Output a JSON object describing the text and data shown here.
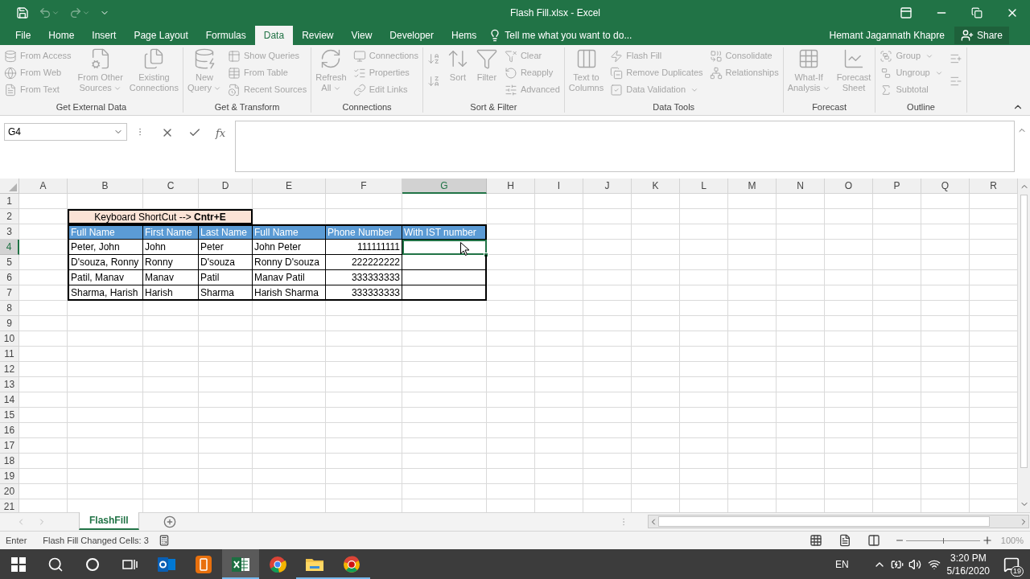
{
  "window": {
    "title": "Flash Fill.xlsx - Excel"
  },
  "menu_tabs": [
    {
      "label": "File",
      "selected": false
    },
    {
      "label": "Home",
      "selected": false
    },
    {
      "label": "Insert",
      "selected": false
    },
    {
      "label": "Page Layout",
      "selected": false
    },
    {
      "label": "Formulas",
      "selected": false
    },
    {
      "label": "Data",
      "selected": true
    },
    {
      "label": "Review",
      "selected": false
    },
    {
      "label": "View",
      "selected": false
    },
    {
      "label": "Developer",
      "selected": false
    },
    {
      "label": "Hems",
      "selected": false
    }
  ],
  "tell_me": {
    "placeholder": "Tell me what you want to do..."
  },
  "account": {
    "user": "Hemant Jagannath Khapre",
    "share": "Share"
  },
  "ribbon": {
    "groups": [
      {
        "label": "Get External Data",
        "columns": [
          [
            {
              "kind": "small",
              "label": "From Access",
              "dropdown": false
            },
            {
              "kind": "small",
              "label": "From Web",
              "dropdown": false
            },
            {
              "kind": "small",
              "label": "From Text",
              "dropdown": false
            }
          ],
          [
            {
              "kind": "large",
              "label": "From Other\nSources",
              "dropdown": true
            }
          ],
          [
            {
              "kind": "large",
              "label": "Existing\nConnections",
              "dropdown": false
            }
          ]
        ]
      },
      {
        "label": "Get & Transform",
        "columns": [
          [
            {
              "kind": "large",
              "label": "New\nQuery",
              "dropdown": true
            }
          ],
          [
            {
              "kind": "small",
              "label": "Show Queries",
              "dropdown": false
            },
            {
              "kind": "small",
              "label": "From Table",
              "dropdown": false
            },
            {
              "kind": "small",
              "label": "Recent Sources",
              "dropdown": false
            }
          ]
        ]
      },
      {
        "label": "Connections",
        "columns": [
          [
            {
              "kind": "large",
              "label": "Refresh\nAll",
              "dropdown": true
            }
          ],
          [
            {
              "kind": "small",
              "label": "Connections",
              "dropdown": false
            },
            {
              "kind": "small",
              "label": "Properties",
              "dropdown": false
            },
            {
              "kind": "small",
              "label": "Edit Links",
              "dropdown": false
            }
          ]
        ]
      },
      {
        "label": "Sort & Filter",
        "columns": [
          [
            {
              "kind": "icon"
            },
            {
              "kind": "icon"
            }
          ],
          [
            {
              "kind": "large",
              "label": "Sort",
              "dropdown": false
            }
          ],
          [
            {
              "kind": "large",
              "label": "Filter",
              "dropdown": false
            }
          ],
          [
            {
              "kind": "small",
              "label": "Clear",
              "dropdown": false
            },
            {
              "kind": "small",
              "label": "Reapply",
              "dropdown": false
            },
            {
              "kind": "small",
              "label": "Advanced",
              "dropdown": false
            }
          ]
        ]
      },
      {
        "label": "Data Tools",
        "columns": [
          [
            {
              "kind": "large",
              "label": "Text to\nColumns",
              "dropdown": false
            }
          ],
          [
            {
              "kind": "small",
              "label": "Flash Fill",
              "dropdown": false
            },
            {
              "kind": "small",
              "label": "Remove Duplicates",
              "dropdown": false
            },
            {
              "kind": "small",
              "label": "Data Validation",
              "dropdown": true
            }
          ],
          [
            {
              "kind": "small",
              "label": "Consolidate",
              "dropdown": false
            },
            {
              "kind": "small",
              "label": "Relationships",
              "dropdown": false
            }
          ]
        ]
      },
      {
        "label": "Forecast",
        "columns": [
          [
            {
              "kind": "large",
              "label": "What-If\nAnalysis",
              "dropdown": true
            }
          ],
          [
            {
              "kind": "large",
              "label": "Forecast\nSheet",
              "dropdown": false
            }
          ]
        ]
      },
      {
        "label": "Outline",
        "columns": [
          [
            {
              "kind": "small",
              "label": "Group",
              "dropdown": true
            },
            {
              "kind": "small",
              "label": "Ungroup",
              "dropdown": true
            },
            {
              "kind": "small",
              "label": "Subtotal",
              "dropdown": false
            }
          ],
          [
            {
              "kind": "icon"
            },
            {
              "kind": "icon"
            }
          ]
        ]
      }
    ]
  },
  "formula_bar": {
    "name_box": "G4",
    "function_label": "fx"
  },
  "sheet": {
    "columns": [
      {
        "label": "A",
        "selected": false
      },
      {
        "label": "B",
        "selected": false
      },
      {
        "label": "C",
        "selected": false
      },
      {
        "label": "D",
        "selected": false
      },
      {
        "label": "E",
        "selected": false
      },
      {
        "label": "F",
        "selected": false
      },
      {
        "label": "G",
        "selected": true
      },
      {
        "label": "H",
        "selected": false
      },
      {
        "label": "I",
        "selected": false
      },
      {
        "label": "J",
        "selected": false
      },
      {
        "label": "K",
        "selected": false
      },
      {
        "label": "L",
        "selected": false
      },
      {
        "label": "M",
        "selected": false
      },
      {
        "label": "N",
        "selected": false
      },
      {
        "label": "O",
        "selected": false
      },
      {
        "label": "P",
        "selected": false
      },
      {
        "label": "Q",
        "selected": false
      },
      {
        "label": "R",
        "selected": false
      }
    ],
    "rows": [
      {
        "label": "1",
        "selected": false
      },
      {
        "label": "2",
        "selected": false
      },
      {
        "label": "3",
        "selected": false
      },
      {
        "label": "4",
        "selected": true
      },
      {
        "label": "5",
        "selected": false
      },
      {
        "label": "6",
        "selected": false
      },
      {
        "label": "7",
        "selected": false
      },
      {
        "label": "8",
        "selected": false
      },
      {
        "label": "9",
        "selected": false
      },
      {
        "label": "10",
        "selected": false
      },
      {
        "label": "11",
        "selected": false
      },
      {
        "label": "12",
        "selected": false
      },
      {
        "label": "13",
        "selected": false
      },
      {
        "label": "14",
        "selected": false
      },
      {
        "label": "15",
        "selected": false
      },
      {
        "label": "16",
        "selected": false
      },
      {
        "label": "17",
        "selected": false
      },
      {
        "label": "18",
        "selected": false
      },
      {
        "label": "19",
        "selected": false
      },
      {
        "label": "20",
        "selected": false
      },
      {
        "label": "21",
        "selected": false
      }
    ],
    "table": {
      "banner": "Keyboard ShortCut --> **Cntr+E**",
      "columns": [
        {
          "label": "Full Name",
          "numeric": false
        },
        {
          "label": "First Name",
          "numeric": false
        },
        {
          "label": "Last Name",
          "numeric": false
        },
        {
          "label": "Full Name",
          "numeric": false
        },
        {
          "label": "Phone Number",
          "numeric": true
        },
        {
          "label": "With IST number",
          "numeric": false
        }
      ],
      "rows": [
        [
          "Peter, John",
          "John",
          "Peter",
          "John Peter",
          "111111111"
        ],
        [
          "D'souza, Ronny",
          "Ronny",
          "D'souza",
          "Ronny D'souza",
          "222222222"
        ],
        [
          "Patil, Manav",
          "Manav",
          "Patil",
          "Manav Patil",
          "333333333"
        ],
        [
          "Sharma, Harish",
          "Harish",
          "Sharma",
          "Harish Sharma",
          "333333333"
        ]
      ]
    }
  },
  "sheet_tabs": [
    {
      "label": "FlashFill",
      "selected": true
    }
  ],
  "status_bar": {
    "mode": "Enter",
    "message": "Flash Fill Changed Cells: 3",
    "zoom": "100%",
    "zoom_slider": {
      "level": 0.5
    }
  },
  "taskbar": {
    "apps": [
      {
        "kind": "start",
        "active": false,
        "running": false
      },
      {
        "kind": "search",
        "active": false,
        "running": false
      },
      {
        "kind": "cortana",
        "active": false,
        "running": false
      },
      {
        "kind": "task_view",
        "active": false,
        "running": false
      },
      {
        "kind": "outlook",
        "active": false,
        "running": false
      },
      {
        "kind": "orange_app",
        "active": false,
        "running": false
      },
      {
        "kind": "excel",
        "active": true,
        "running": true
      },
      {
        "kind": "chrome",
        "active": false,
        "running": false
      },
      {
        "kind": "explorer",
        "active": false,
        "running": true
      },
      {
        "kind": "red_browser",
        "active": false,
        "running": true
      }
    ],
    "language": "EN",
    "time": "3:20 PM",
    "date": "5/16/2020",
    "notifications": "19"
  }
}
